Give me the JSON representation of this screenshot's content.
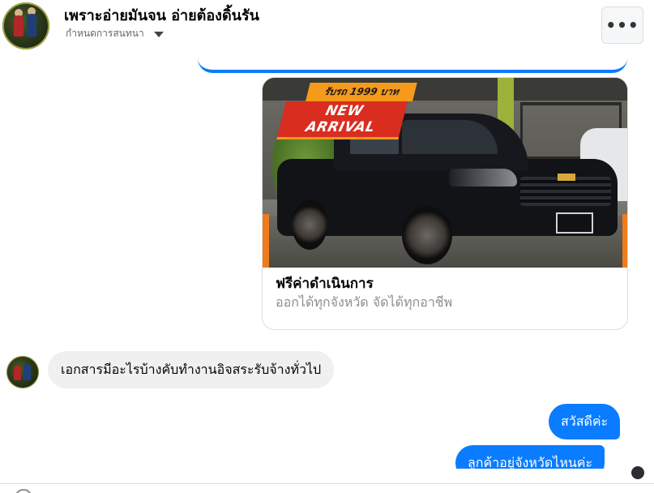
{
  "header": {
    "title": "เพราะอ่ายมันจน อ่ายต้องดิ้นรัน",
    "subtitle": "กำหนดการสนทนา",
    "more_label": "•••"
  },
  "ad_card": {
    "image_badge_top": "รับรถ 1999 บาท",
    "image_badge_main": "NEW ARRIVAL",
    "title": "ฟรีค่าดำเนินการ",
    "subtitle": "ออกได้ทุกจังหวัด จัดได้ทุกอาชีพ"
  },
  "messages": {
    "incoming": [
      {
        "text": "เอกสารมีอะไรบ้างคับทำงานอิจสระรับจ้างทั่วไป"
      }
    ],
    "outgoing": [
      {
        "text": "สวัสดีค่ะ"
      },
      {
        "text": "ลูกค้าอยู่จังหวัดไหนค่ะ"
      }
    ]
  },
  "colors": {
    "outgoing_bubble": "#0a7cff",
    "incoming_bubble": "#f0f0f0",
    "badge_red": "#d92d20",
    "badge_orange": "#f59a1b"
  },
  "icons": {
    "more": "more-horizontal-icon",
    "caret": "caret-down-icon"
  }
}
